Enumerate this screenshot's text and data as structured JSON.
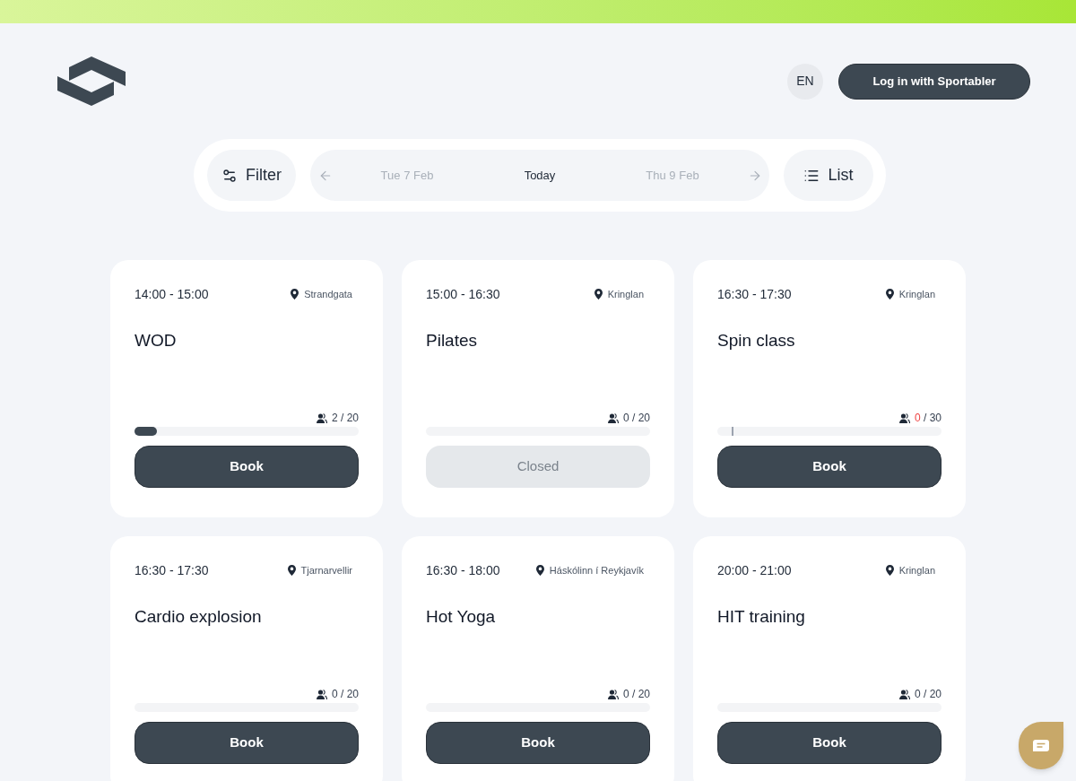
{
  "header": {
    "language": "EN",
    "login_button": "Log in with Sportabler"
  },
  "toolbar": {
    "filter": "Filter",
    "dates": [
      {
        "label": "Tue 7 Feb",
        "selected": false
      },
      {
        "label": "Today",
        "selected": true
      },
      {
        "label": "Thu 9 Feb",
        "selected": false
      }
    ],
    "view": "List"
  },
  "classes": [
    {
      "time": "14:00 - 15:00",
      "location": "Strandgata",
      "title": "WOD",
      "booked": "2",
      "of_total": "/ 20",
      "booked_alert": false,
      "marker": false,
      "level": 0.1,
      "button": {
        "label": "Book",
        "disabled": false
      }
    },
    {
      "time": "15:00 - 16:30",
      "location": "Kringlan",
      "title": "Pilates",
      "booked": "0",
      "of_total": "/ 20",
      "booked_alert": false,
      "marker": false,
      "level": 0,
      "button": {
        "label": "Closed",
        "disabled": true
      }
    },
    {
      "time": "16:30 - 17:30",
      "location": "Kringlan",
      "title": "Spin class",
      "booked": "0",
      "of_total": "/ 30",
      "booked_alert": true,
      "marker": true,
      "level": 0,
      "button": {
        "label": "Book",
        "disabled": false
      }
    },
    {
      "time": "16:30 - 17:30",
      "location": "Tjarnarvellir",
      "title": "Cardio explosion",
      "booked": "0",
      "of_total": "/ 20",
      "booked_alert": false,
      "marker": false,
      "level": 0,
      "button": {
        "label": "Book",
        "disabled": false
      }
    },
    {
      "time": "16:30 - 18:00",
      "location": "Háskólinn í Reykjavík",
      "title": "Hot Yoga",
      "booked": "0",
      "of_total": "/ 20",
      "booked_alert": false,
      "marker": false,
      "level": 0,
      "button": {
        "label": "Book",
        "disabled": false
      }
    },
    {
      "time": "20:00 - 21:00",
      "location": "Kringlan",
      "title": "HIT training",
      "booked": "0",
      "of_total": "/ 20",
      "booked_alert": false,
      "marker": false,
      "level": 0,
      "button": {
        "label": "Book",
        "disabled": false
      }
    }
  ]
}
